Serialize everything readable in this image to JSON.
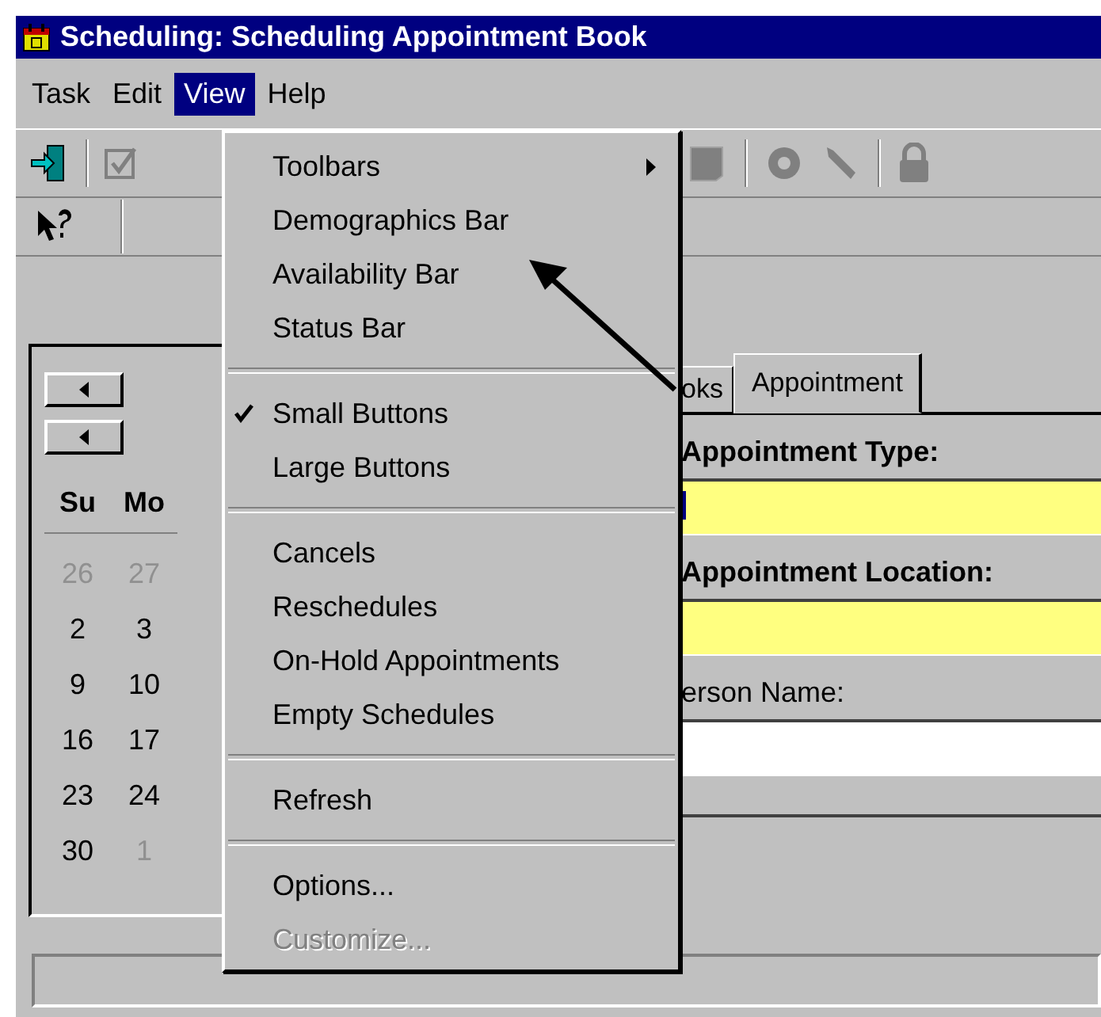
{
  "window": {
    "title": "Scheduling: Scheduling Appointment Book"
  },
  "menubar": [
    {
      "label": "Task",
      "selected": false
    },
    {
      "label": "Edit",
      "selected": false
    },
    {
      "label": "View",
      "selected": true
    },
    {
      "label": "Help",
      "selected": false
    }
  ],
  "view_menu": [
    {
      "kind": "item",
      "label": "Toolbars",
      "submenu": true,
      "checked": false,
      "disabled": false
    },
    {
      "kind": "item",
      "label": "Demographics Bar",
      "submenu": false,
      "checked": false,
      "disabled": false
    },
    {
      "kind": "item",
      "label": "Availability Bar",
      "submenu": false,
      "checked": false,
      "disabled": false
    },
    {
      "kind": "item",
      "label": "Status Bar",
      "submenu": false,
      "checked": false,
      "disabled": false
    },
    {
      "kind": "separator"
    },
    {
      "kind": "item",
      "label": "Small Buttons",
      "submenu": false,
      "checked": true,
      "disabled": false
    },
    {
      "kind": "item",
      "label": "Large Buttons",
      "submenu": false,
      "checked": false,
      "disabled": false
    },
    {
      "kind": "separator"
    },
    {
      "kind": "item",
      "label": "Cancels",
      "submenu": false,
      "checked": false,
      "disabled": false
    },
    {
      "kind": "item",
      "label": "Reschedules",
      "submenu": false,
      "checked": false,
      "disabled": false
    },
    {
      "kind": "item",
      "label": "On-Hold Appointments",
      "submenu": false,
      "checked": false,
      "disabled": false
    },
    {
      "kind": "item",
      "label": "Empty Schedules",
      "submenu": false,
      "checked": false,
      "disabled": false
    },
    {
      "kind": "separator"
    },
    {
      "kind": "item",
      "label": "Refresh",
      "submenu": false,
      "checked": false,
      "disabled": false
    },
    {
      "kind": "separator"
    },
    {
      "kind": "item",
      "label": "Options...",
      "submenu": false,
      "checked": false,
      "disabled": false
    },
    {
      "kind": "item",
      "label": "Customize...",
      "submenu": false,
      "checked": false,
      "disabled": true
    }
  ],
  "calendar": {
    "weekdays": [
      "Su",
      "Mo"
    ],
    "weeks": [
      [
        {
          "day": "26",
          "other_month": true
        },
        {
          "day": "27",
          "other_month": true
        }
      ],
      [
        {
          "day": "2",
          "other_month": false
        },
        {
          "day": "3",
          "other_month": false
        }
      ],
      [
        {
          "day": "9",
          "other_month": false
        },
        {
          "day": "10",
          "other_month": false
        }
      ],
      [
        {
          "day": "16",
          "other_month": false
        },
        {
          "day": "17",
          "other_month": false
        }
      ],
      [
        {
          "day": "23",
          "other_month": false
        },
        {
          "day": "24",
          "other_month": false
        }
      ],
      [
        {
          "day": "30",
          "other_month": false
        },
        {
          "day": "1",
          "other_month": true
        }
      ]
    ]
  },
  "tabs": [
    {
      "label": "oks",
      "selected": false
    },
    {
      "label": "Appointment",
      "selected": true
    }
  ],
  "fields": [
    {
      "label": "Appointment Type:",
      "required": true,
      "focused": true
    },
    {
      "label": "Appointment Location:",
      "required": true,
      "focused": false
    },
    {
      "label": "erson Name:",
      "required": false,
      "focused": false
    }
  ]
}
